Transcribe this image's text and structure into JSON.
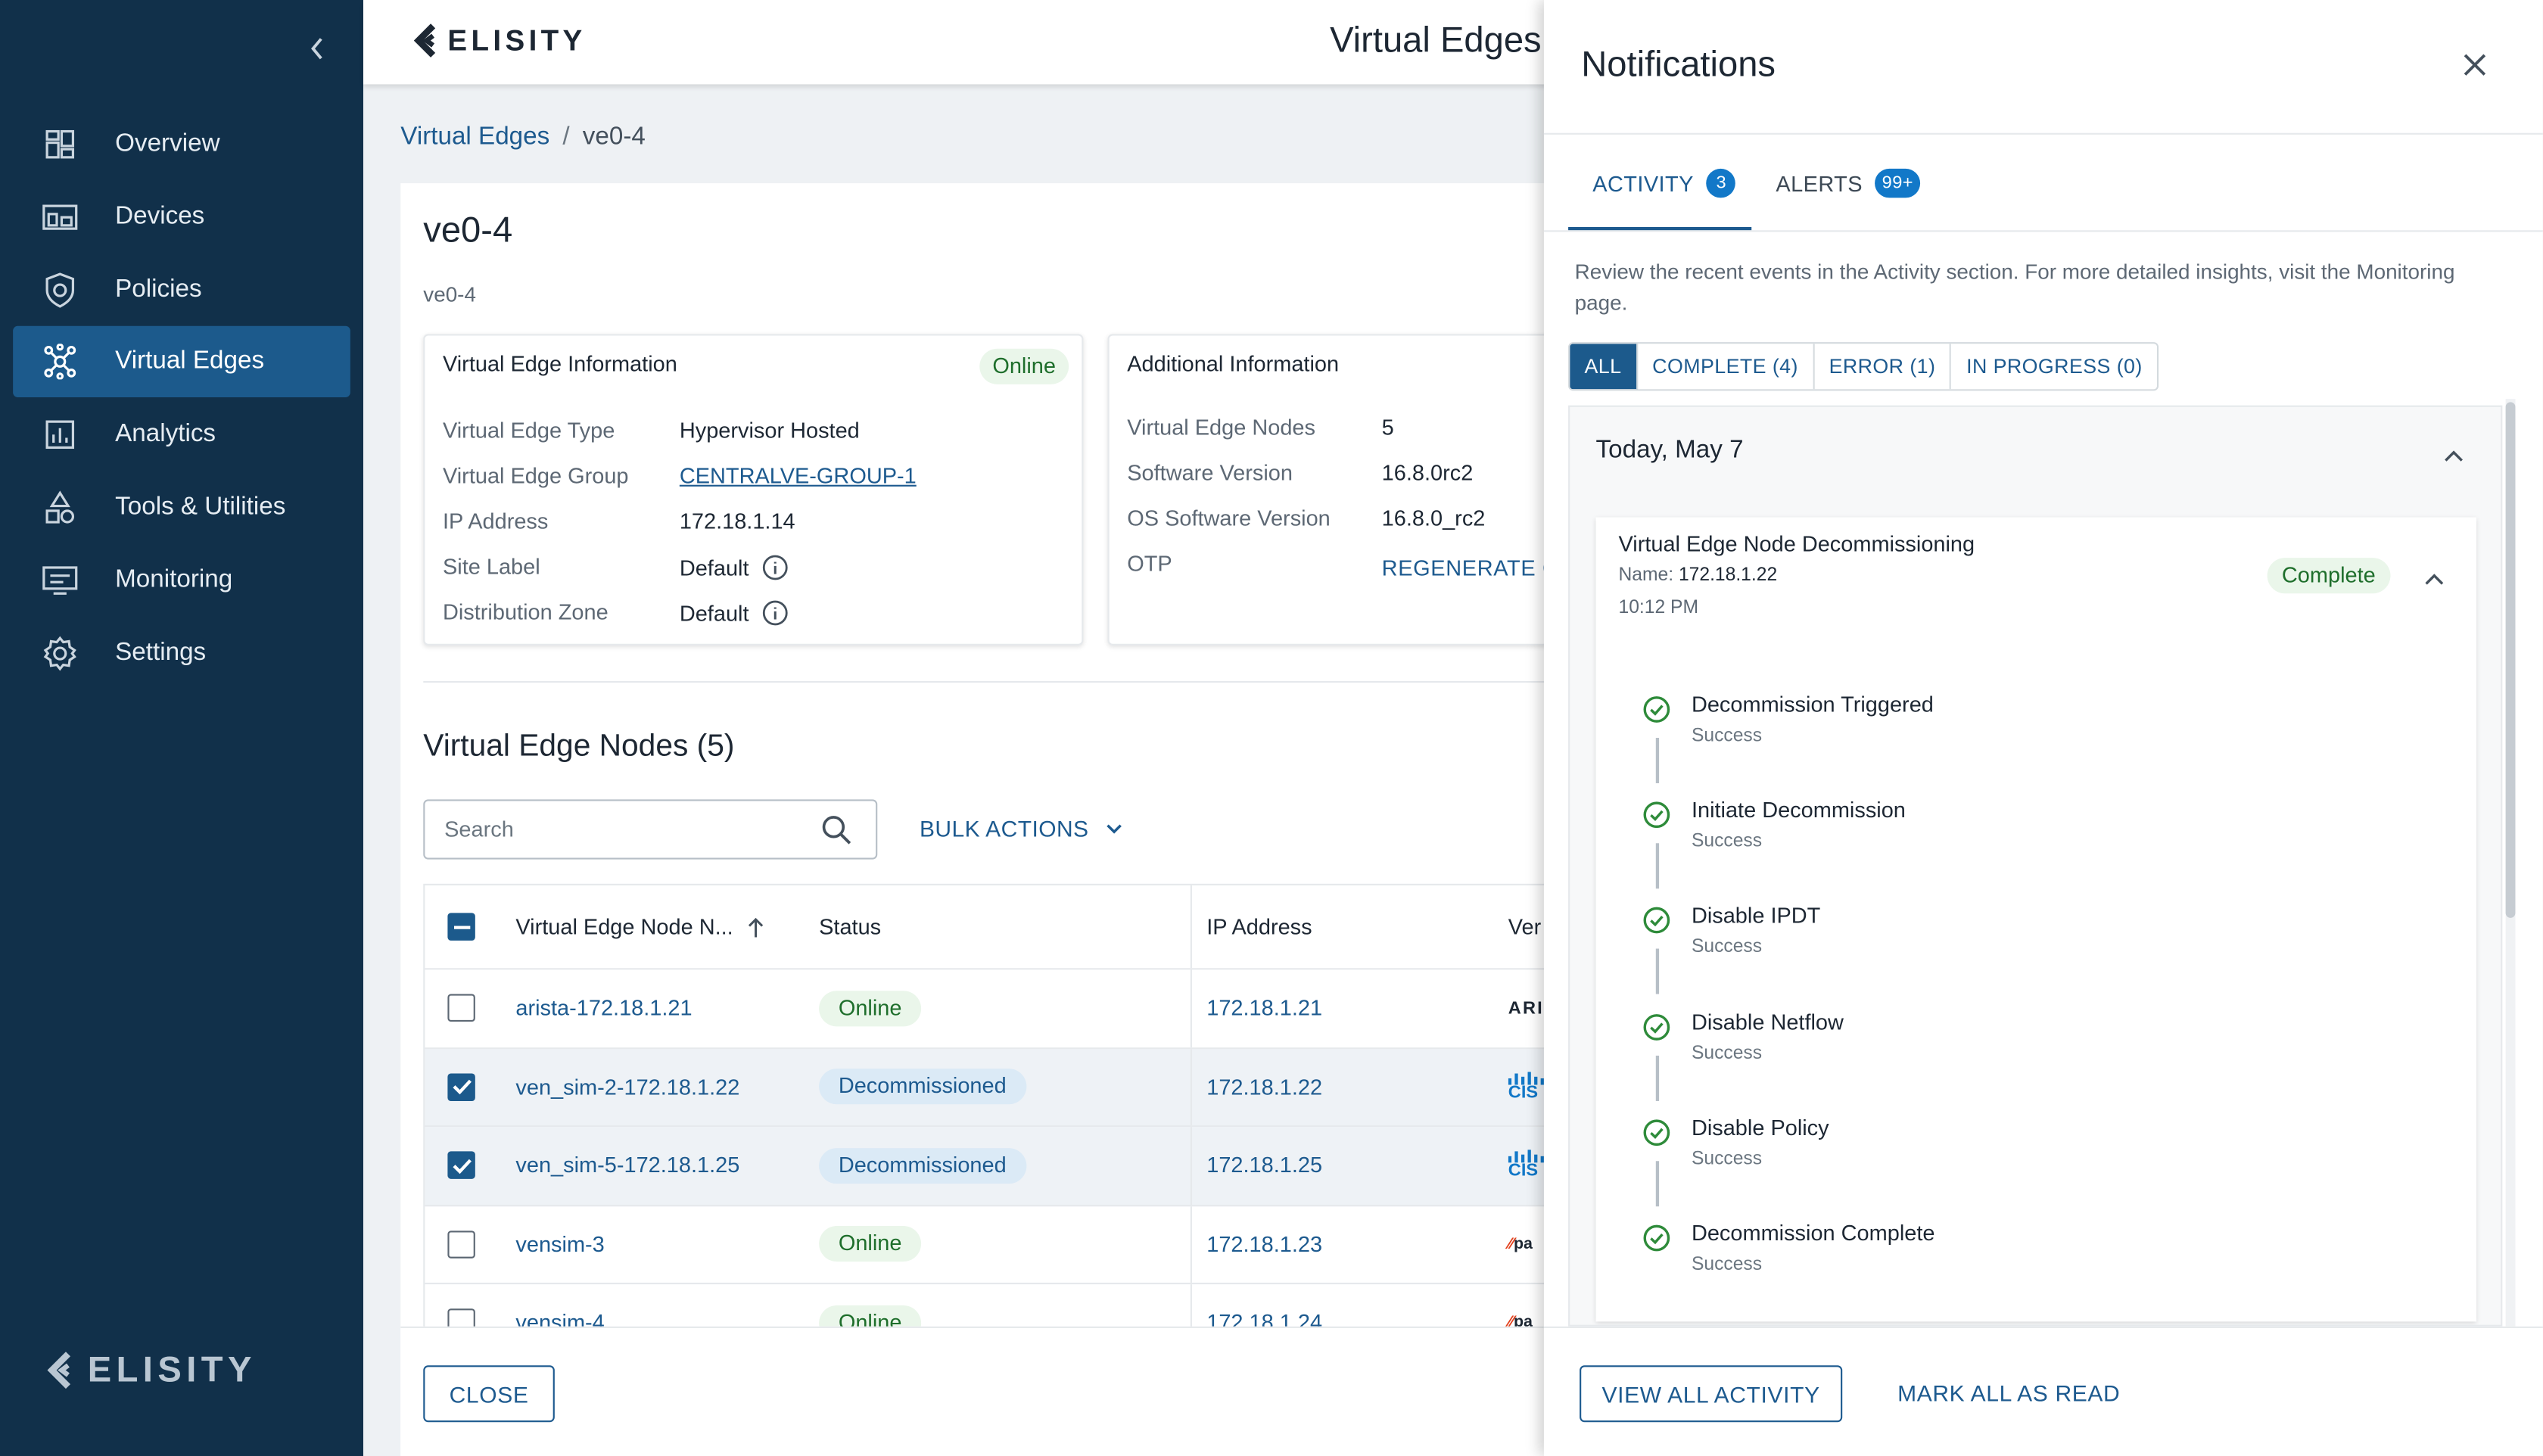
{
  "brand": "ELISITY",
  "header": {
    "title": "Virtual Edges"
  },
  "sidebar": {
    "items": [
      {
        "label": "Overview",
        "icon": "overview-icon"
      },
      {
        "label": "Devices",
        "icon": "devices-icon"
      },
      {
        "label": "Policies",
        "icon": "policies-icon"
      },
      {
        "label": "Virtual Edges",
        "icon": "virtual-edges-icon",
        "active": true
      },
      {
        "label": "Analytics",
        "icon": "analytics-icon"
      },
      {
        "label": "Tools & Utilities",
        "icon": "tools-icon"
      },
      {
        "label": "Monitoring",
        "icon": "monitoring-icon"
      },
      {
        "label": "Settings",
        "icon": "settings-icon"
      }
    ]
  },
  "breadcrumb": {
    "root": "Virtual Edges",
    "current": "ve0-4"
  },
  "detail": {
    "title": "ve0-4",
    "subtitle": "ve0-4",
    "ve_info": {
      "title": "Virtual Edge Information",
      "status": "Online",
      "rows": [
        {
          "k": "Virtual Edge Type",
          "v": "Hypervisor Hosted"
        },
        {
          "k": "Virtual Edge Group",
          "v": "CENTRALVE-GROUP-1"
        },
        {
          "k": "IP Address",
          "v": "172.18.1.14"
        },
        {
          "k": "Site Label",
          "v": "Default"
        },
        {
          "k": "Distribution Zone",
          "v": "Default"
        }
      ]
    },
    "additional": {
      "title": "Additional Information",
      "rows": [
        {
          "k": "Virtual Edge Nodes",
          "v": "5"
        },
        {
          "k": "Software Version",
          "v": "16.8.0rc2"
        },
        {
          "k": "OS Software Version",
          "v": "16.8.0_rc2"
        },
        {
          "k": "OTP",
          "v": "REGENERATE CF"
        }
      ]
    }
  },
  "nodes": {
    "title": "Virtual Edge Nodes (5)",
    "search_placeholder": "Search",
    "bulk_actions": "BULK ACTIONS",
    "columns": {
      "name": "Virtual Edge Node N...",
      "status": "Status",
      "ip": "IP Address",
      "version": "Ver"
    },
    "rows": [
      {
        "name": "arista-172.18.1.21",
        "status": "Online",
        "ip": "172.18.1.21",
        "vendor": "ARI",
        "checked": false
      },
      {
        "name": "ven_sim-2-172.18.1.22",
        "status": "Decommissioned",
        "ip": "172.18.1.22",
        "vendor": "CIS",
        "checked": true
      },
      {
        "name": "ven_sim-5-172.18.1.25",
        "status": "Decommissioned",
        "ip": "172.18.1.25",
        "vendor": "CIS",
        "checked": true
      },
      {
        "name": "vensim-3",
        "status": "Online",
        "ip": "172.18.1.23",
        "vendor": "pa",
        "checked": false
      },
      {
        "name": "vensim-4",
        "status": "Online",
        "ip": "172.18.1.24",
        "vendor": "pa",
        "checked": false
      }
    ]
  },
  "footer": {
    "close": "CLOSE"
  },
  "notifications": {
    "title": "Notifications",
    "tabs": [
      {
        "label": "ACTIVITY",
        "badge": "3"
      },
      {
        "label": "ALERTS",
        "badge": "99+"
      }
    ],
    "description": "Review the recent events in the Activity section. For more detailed insights, visit the Monitoring page.",
    "filters": [
      "ALL",
      "COMPLETE (4)",
      "ERROR (1)",
      "IN PROGRESS (0)"
    ],
    "date_group": "Today, May 7",
    "event": {
      "title": "Virtual Edge Node Decommissioning",
      "name_label": "Name:",
      "name_value": "172.18.1.22",
      "time": "10:12 PM",
      "status": "Complete",
      "steps": [
        {
          "name": "Decommission Triggered",
          "status": "Success"
        },
        {
          "name": "Initiate Decommission",
          "status": "Success"
        },
        {
          "name": "Disable IPDT",
          "status": "Success"
        },
        {
          "name": "Disable Netflow",
          "status": "Success"
        },
        {
          "name": "Disable Policy",
          "status": "Success"
        },
        {
          "name": "Decommission Complete",
          "status": "Success"
        }
      ]
    },
    "view_all": "VIEW ALL ACTIVITY",
    "mark_all": "MARK ALL AS READ"
  },
  "colors": {
    "sidebar": "#11304a",
    "accent": "#1c5a8c",
    "success": "#2e8b3a"
  }
}
